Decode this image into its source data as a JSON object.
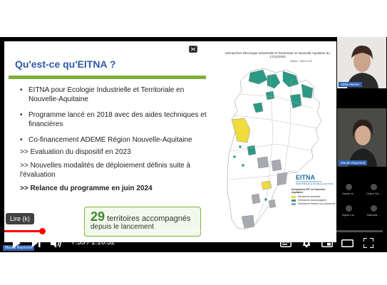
{
  "slide": {
    "title": "Qu'est-ce qu'EITNA ?",
    "bullets": [
      "EITNA pour Ecologie Industrielle et Territoriale en Nouvelle-Aquitaine",
      "Programme lancé en 2018  avec des aides techniques et financières",
      "Co-financement ADEME Région Nouvelle-Aquitaine"
    ],
    "arrows": [
      ">> Evaluation du dispositif en 2023",
      ">> Nouvelles modalités de déploiement définis suite à l'évaluation",
      ">> Relance du programme en juin 2024"
    ],
    "callout": {
      "number": "29",
      "text1": " territoires accompagnés",
      "text2": "depuis le lancement"
    }
  },
  "map": {
    "title": "Démarches d'Ecologie Industrielle et Territoriale en Nouvelle-Aquitaine au 17/11/2023",
    "edition": "Edition : 2023 v1.92",
    "legend": {
      "logo": "EITNA",
      "logo_sub": "ECOLOGIE INDUSTRIELLE ET TERRITORIALE EN NOUVELLE-AQUITAINE",
      "title": "Démarches EIT en Nouvelle-Aquitaine",
      "items": [
        {
          "label": "Démarche amorcée",
          "color": "#f0dc3a"
        },
        {
          "label": "Démarche accompagnée",
          "color": "#2a9a84"
        },
        {
          "label": "Démarche éteinte non poursuivie",
          "color": "#9aa0a6"
        }
      ]
    },
    "colors": {
      "green": "#2a9a84",
      "yellow": "#f0dc3a",
      "grey": "#a7abb0",
      "region": "#ffffff",
      "border": "#9a9a9a"
    }
  },
  "participants": {
    "main": [
      {
        "name": "Sbilla Meisen"
      },
      {
        "name": "Maude Raymond"
      }
    ],
    "grid": [
      {
        "name": "Xavier A..."
      },
      {
        "name": "Claire Ga..."
      },
      {
        "name": "Sylvie La..."
      },
      {
        "name": "Barbara ..."
      }
    ]
  },
  "player": {
    "lire_label": "Lire (k)",
    "speaker_label": "Maude Raymond",
    "current_time": "7:35",
    "separator": " / ",
    "duration": "1:16:32",
    "progress_fraction": 0.1
  }
}
